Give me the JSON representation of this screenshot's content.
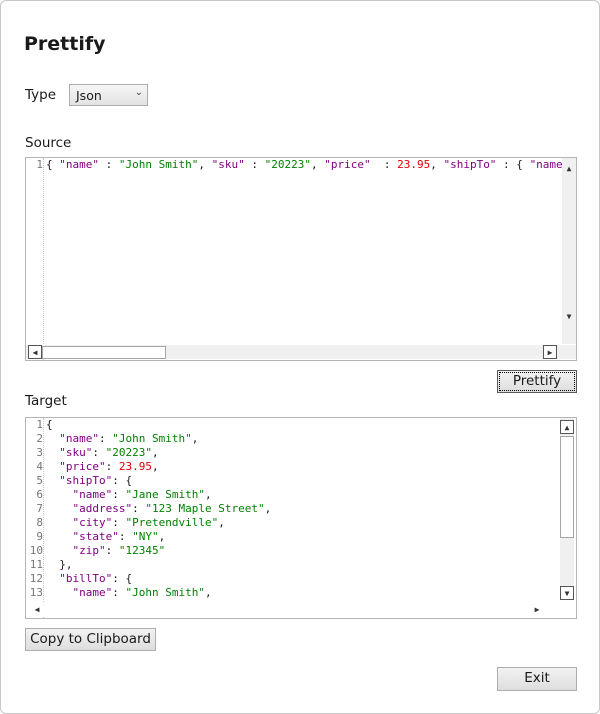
{
  "window": {
    "title": "Prettify"
  },
  "type": {
    "label": "Type",
    "selected": "Json"
  },
  "source": {
    "label": "Source",
    "line_numbers": [
      "1"
    ],
    "lines": [
      [
        [
          "punc",
          "{ "
        ],
        [
          "key",
          "\"name\""
        ],
        [
          "punc",
          " : "
        ],
        [
          "str",
          "\"John Smith\""
        ],
        [
          "punc",
          ", "
        ],
        [
          "key",
          "\"sku\""
        ],
        [
          "punc",
          " : "
        ],
        [
          "str",
          "\"20223\""
        ],
        [
          "punc",
          ", "
        ],
        [
          "key",
          "\"price\""
        ],
        [
          "punc",
          "  : "
        ],
        [
          "num",
          "23.95"
        ],
        [
          "punc",
          ", "
        ],
        [
          "key",
          "\"shipTo\""
        ],
        [
          "punc",
          " : { "
        ],
        [
          "key",
          "\"name"
        ]
      ]
    ]
  },
  "prettify_button": "Prettify",
  "target": {
    "label": "Target",
    "line_numbers": [
      "1",
      "2",
      "3",
      "4",
      "5",
      "6",
      "7",
      "8",
      "9",
      "10",
      "11",
      "12",
      "13"
    ],
    "lines": [
      [
        [
          "punc",
          "{"
        ]
      ],
      [
        [
          "punc",
          "  "
        ],
        [
          "key",
          "\"name\""
        ],
        [
          "punc",
          ": "
        ],
        [
          "str",
          "\"John Smith\""
        ],
        [
          "punc",
          ","
        ]
      ],
      [
        [
          "punc",
          "  "
        ],
        [
          "key",
          "\"sku\""
        ],
        [
          "punc",
          ": "
        ],
        [
          "str",
          "\"20223\""
        ],
        [
          "punc",
          ","
        ]
      ],
      [
        [
          "punc",
          "  "
        ],
        [
          "key",
          "\"price\""
        ],
        [
          "punc",
          ": "
        ],
        [
          "num",
          "23.95"
        ],
        [
          "punc",
          ","
        ]
      ],
      [
        [
          "punc",
          "  "
        ],
        [
          "key",
          "\"shipTo\""
        ],
        [
          "punc",
          ": {"
        ]
      ],
      [
        [
          "punc",
          "    "
        ],
        [
          "key",
          "\"name\""
        ],
        [
          "punc",
          ": "
        ],
        [
          "str",
          "\"Jane Smith\""
        ],
        [
          "punc",
          ","
        ]
      ],
      [
        [
          "punc",
          "    "
        ],
        [
          "key",
          "\"address\""
        ],
        [
          "punc",
          ": "
        ],
        [
          "str",
          "\"123 Maple Street\""
        ],
        [
          "punc",
          ","
        ]
      ],
      [
        [
          "punc",
          "    "
        ],
        [
          "key",
          "\"city\""
        ],
        [
          "punc",
          ": "
        ],
        [
          "str",
          "\"Pretendville\""
        ],
        [
          "punc",
          ","
        ]
      ],
      [
        [
          "punc",
          "    "
        ],
        [
          "key",
          "\"state\""
        ],
        [
          "punc",
          ": "
        ],
        [
          "str",
          "\"NY\""
        ],
        [
          "punc",
          ","
        ]
      ],
      [
        [
          "punc",
          "    "
        ],
        [
          "key",
          "\"zip\""
        ],
        [
          "punc",
          ": "
        ],
        [
          "str",
          "\"12345\""
        ]
      ],
      [
        [
          "punc",
          "  },"
        ]
      ],
      [
        [
          "punc",
          "  "
        ],
        [
          "key",
          "\"billTo\""
        ],
        [
          "punc",
          ": {"
        ]
      ],
      [
        [
          "punc",
          "    "
        ],
        [
          "key",
          "\"name\""
        ],
        [
          "punc",
          ": "
        ],
        [
          "str",
          "\"John Smith\""
        ],
        [
          "punc",
          ","
        ]
      ]
    ]
  },
  "copy_button": "Copy to Clipboard",
  "exit_button": "Exit",
  "colors": {
    "key": "#800080",
    "string": "#008000",
    "number": "#e00000"
  }
}
